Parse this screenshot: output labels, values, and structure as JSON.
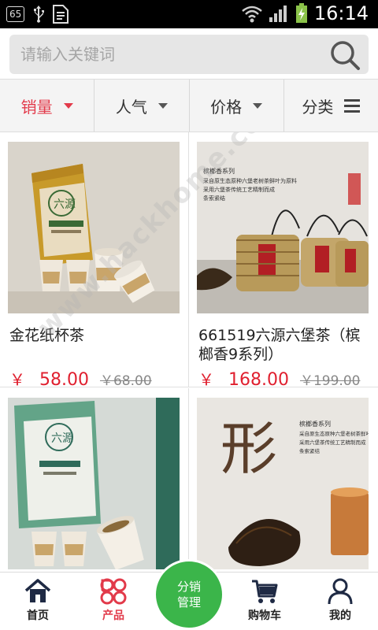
{
  "status_bar": {
    "badge": "65",
    "time": "16:14"
  },
  "search": {
    "placeholder": "请输入关键词"
  },
  "sort_tabs": [
    {
      "label": "销量",
      "active": true
    },
    {
      "label": "人气",
      "active": false
    },
    {
      "label": "价格",
      "active": false
    },
    {
      "label": "分类",
      "active": false
    }
  ],
  "products": [
    {
      "name": "金花纸杯茶",
      "currency": "￥",
      "price": "58.00",
      "old_price": "￥68.00"
    },
    {
      "name": "661519六源六堡茶（槟榔香9系列）",
      "currency": "￥",
      "price": "168.00",
      "old_price": "￥199.00"
    },
    {
      "name": "",
      "currency": "",
      "price": "",
      "old_price": ""
    },
    {
      "name": "",
      "currency": "",
      "price": "",
      "old_price": ""
    }
  ],
  "image_text": {
    "brand": "六源",
    "series_line1": "槟榔香系列",
    "series_line2": "采自原生态原种六堡老树茶鲜叶为原料",
    "series_line3": "采用六堡茶传统工艺精制而成",
    "series_line4": "条索紧结",
    "calligraphy": "形"
  },
  "bottom_nav": {
    "home": "首页",
    "products": "产品",
    "center_line1": "分销",
    "center_line2": "管理",
    "cart": "购物车",
    "mine": "我的"
  },
  "watermark": "www.hackhome.com",
  "colors": {
    "accent_red": "#e23a4a",
    "price_red": "#e0202f",
    "center_green": "#3bb54a"
  }
}
